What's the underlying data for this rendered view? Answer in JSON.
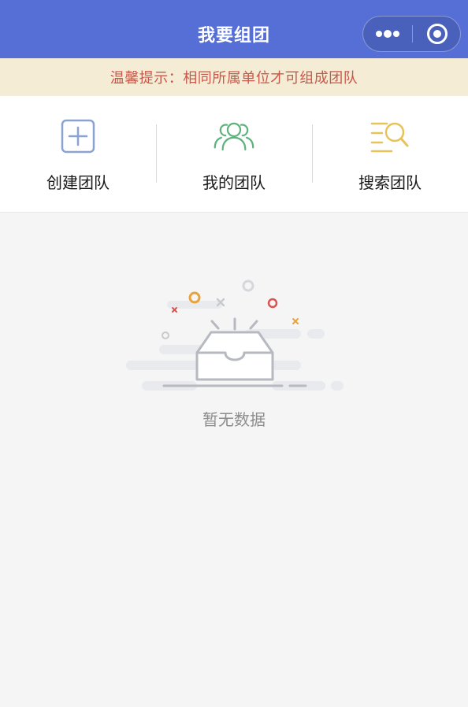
{
  "navbar": {
    "title": "我要组团",
    "bg_color": "#556fd6",
    "more_icon": "more-dots-icon",
    "close_icon": "target-circle-icon"
  },
  "tip": {
    "text": "温馨提示：相同所属单位才可组成团队",
    "text_color": "#c9584a",
    "bg_color": "#f5ecd6"
  },
  "actions": [
    {
      "label": "创建团队",
      "icon": "plus-square-icon",
      "color": "#8aa4cf"
    },
    {
      "label": "我的团队",
      "icon": "users-group-icon",
      "color": "#5fb17e"
    },
    {
      "label": "搜索团队",
      "icon": "search-list-icon",
      "color": "#e8c35a"
    }
  ],
  "empty_state": {
    "text": "暂无数据",
    "illustration": "empty-inbox-icon"
  }
}
